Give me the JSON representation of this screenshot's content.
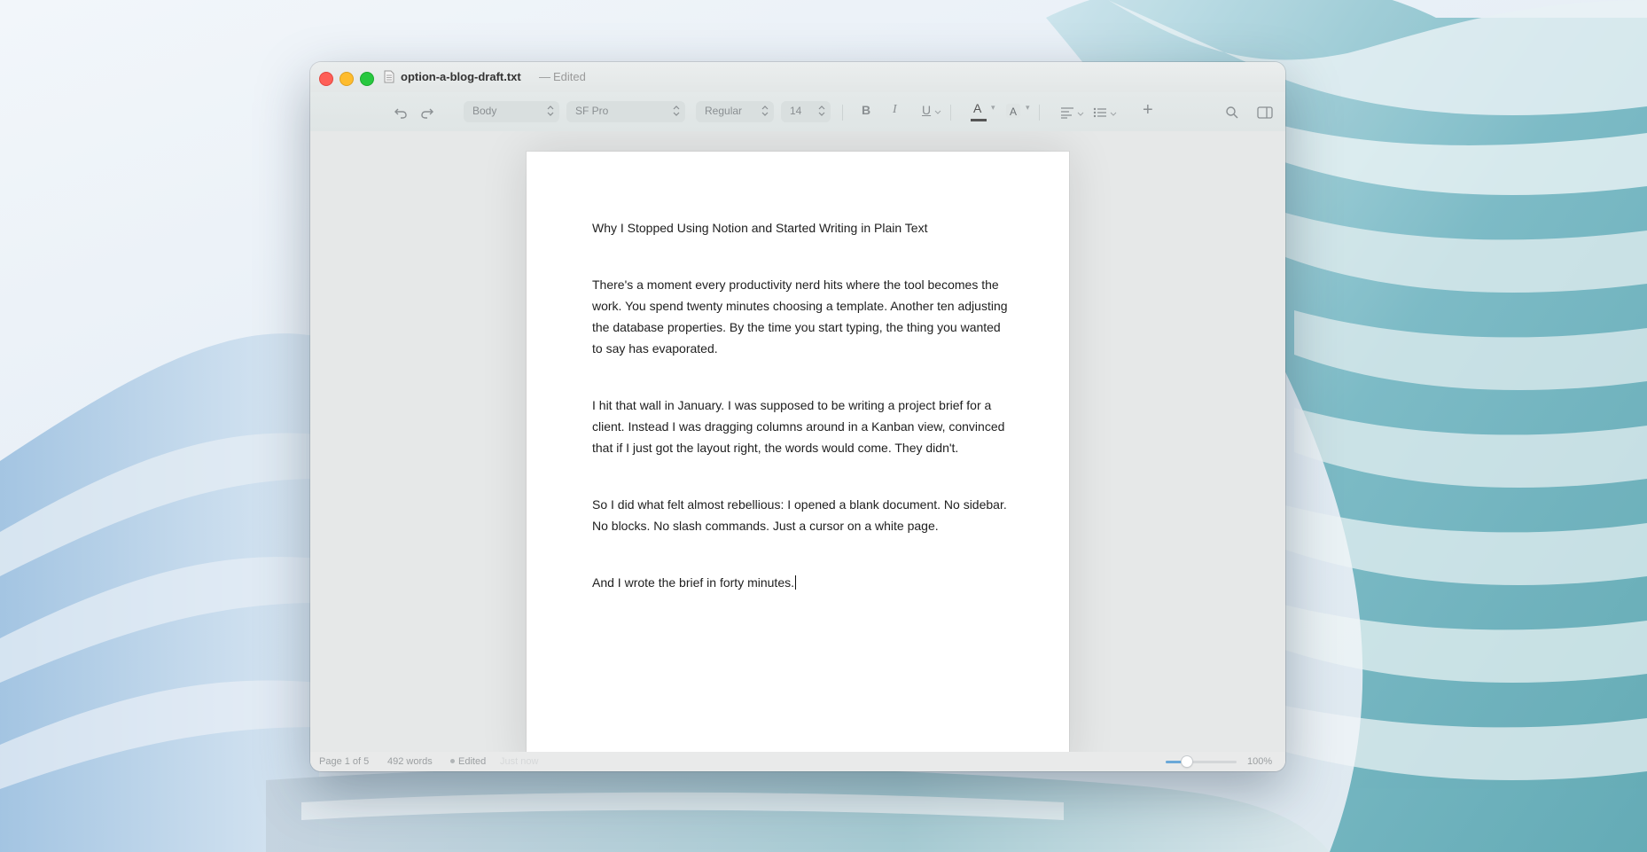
{
  "window": {
    "filename": "option-a-blog-draft.txt",
    "separator": "—",
    "status": "Edited"
  },
  "toolbar": {
    "style": "Body",
    "font": "SF Pro",
    "weight": "Regular",
    "size": "14",
    "bold": "B",
    "italic": "I",
    "underline": "U",
    "text_color_glyph": "A",
    "highlight_glyph": "A",
    "add": "+"
  },
  "document": {
    "title": "Why I Stopped Using Notion and Started Writing in Plain Text",
    "paragraphs": [
      "There's a moment every productivity nerd hits where the tool becomes the work. You spend twenty minutes choosing a template. Another ten adjusting the database properties. By the time you start typing, the thing you wanted to say has evaporated.",
      "I hit that wall in January. I was supposed to be writing a project brief for a client. Instead I was dragging columns around in a Kanban view, convinced that if I just got the layout right, the words would come. They didn't.",
      "So I did what felt almost rebellious: I opened a blank document. No sidebar. No blocks. No slash commands. Just a cursor on a white page.",
      "And I wrote the brief in forty minutes."
    ]
  },
  "statusbar": {
    "page": "Page 1 of 5",
    "words": "492 words",
    "edited": "Edited",
    "saved": "Just now",
    "zoom": "100%",
    "zoom_level": 0.3
  },
  "colors": {
    "close": "#fe5f57",
    "minimize": "#febc2e",
    "maximize": "#28c840",
    "accent": "#6aa8d8"
  }
}
